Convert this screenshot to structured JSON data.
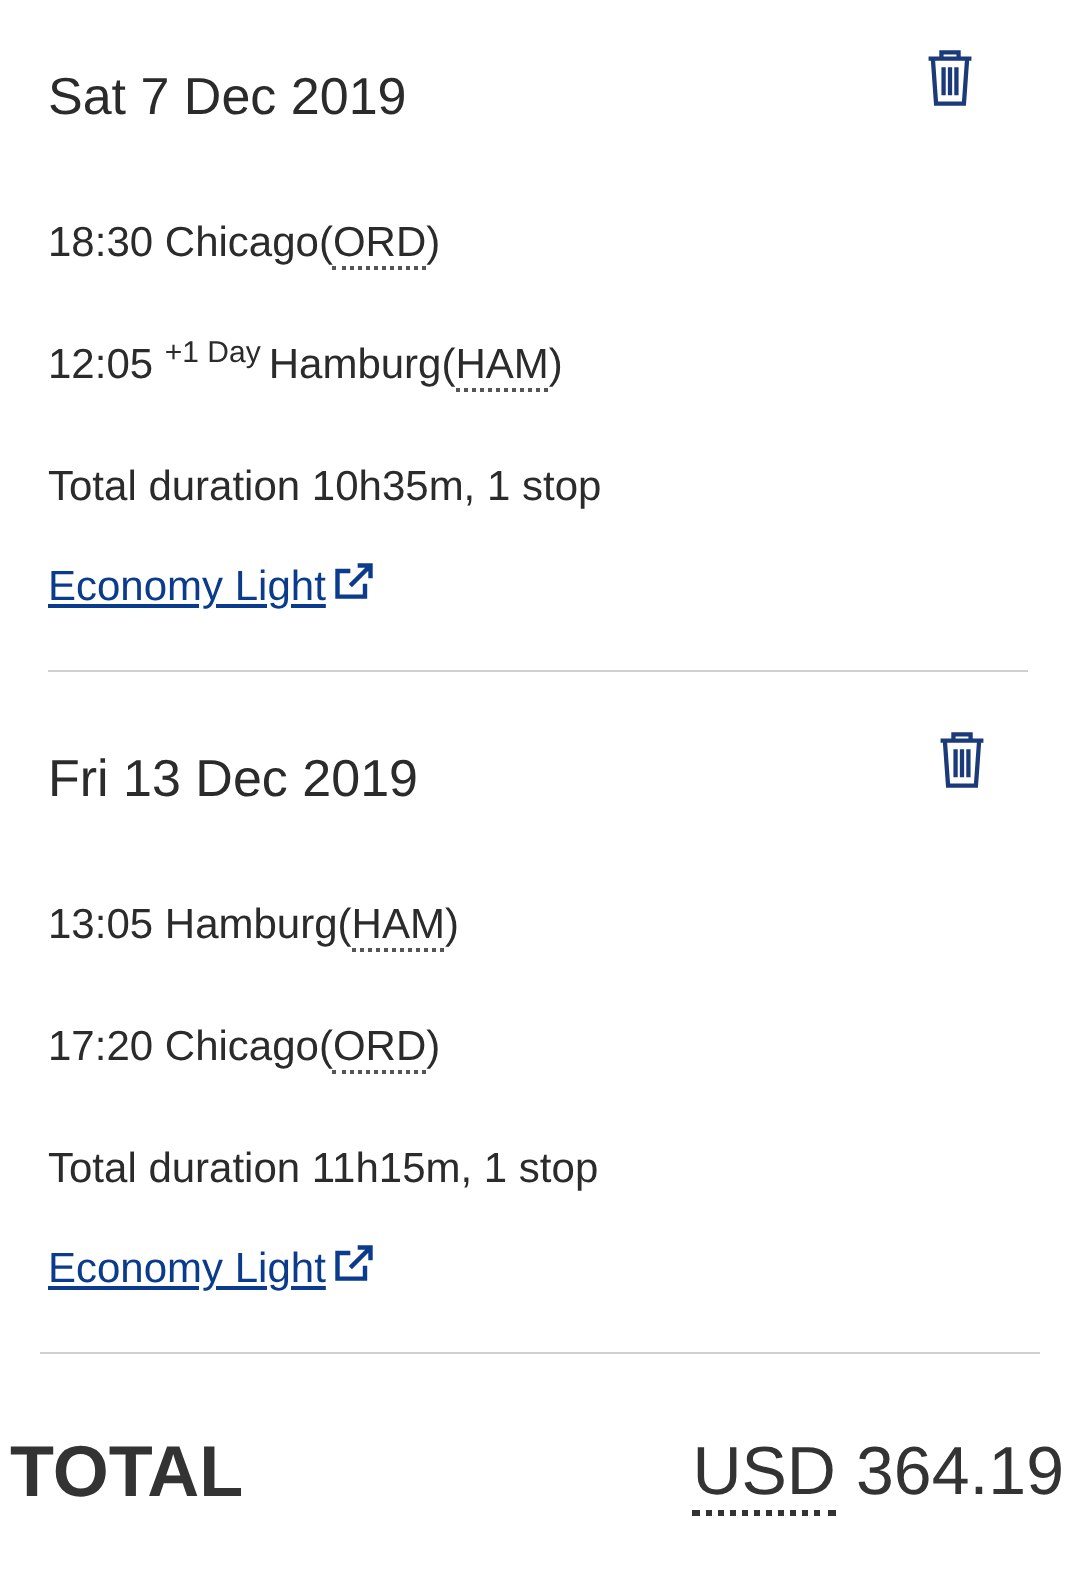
{
  "segments": [
    {
      "date": "Sat 7 Dec 2019",
      "departure": {
        "time": "18:30",
        "city": "Chicago",
        "code": "(ORD)"
      },
      "arrival": {
        "time": "12:05",
        "day_offset": "+1 Day",
        "city": "Hamburg",
        "code": "(HAM)"
      },
      "duration": "Total duration 10h35m, 1 stop",
      "fare": "Economy Light"
    },
    {
      "date": "Fri 13 Dec 2019",
      "departure": {
        "time": "13:05",
        "city": "Hamburg",
        "code": "(HAM)"
      },
      "arrival": {
        "time": "17:20",
        "city": "Chicago",
        "code": "(ORD)"
      },
      "duration": "Total duration 11h15m, 1 stop",
      "fare": "Economy Light"
    }
  ],
  "total": {
    "label": "TOTAL",
    "currency": "USD",
    "amount": "364.19"
  }
}
